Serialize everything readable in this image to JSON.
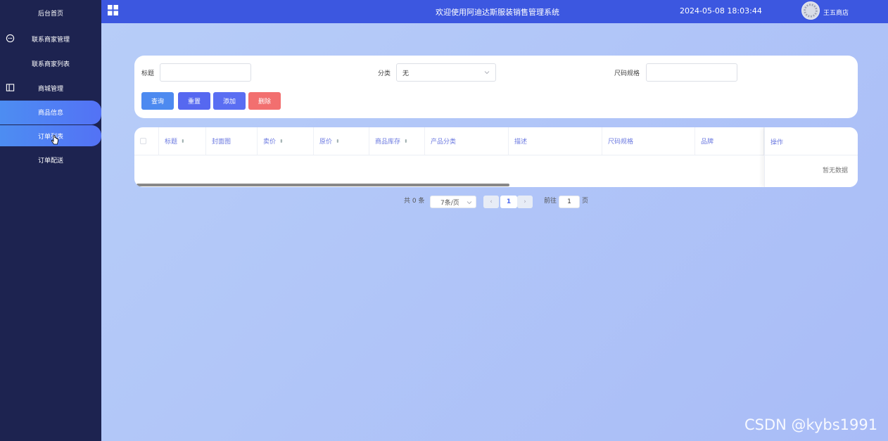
{
  "sidebar": {
    "items": [
      {
        "label": "后台首页"
      },
      {
        "label": "联系商家管理",
        "icon": "chat-icon"
      },
      {
        "label": "联系商家列表"
      },
      {
        "label": "商城管理",
        "icon": "columns-icon"
      },
      {
        "label": "商品信息"
      },
      {
        "label": "订单列表"
      },
      {
        "label": "订单配送"
      }
    ]
  },
  "header": {
    "title": "欢迎使用阿迪达斯服装销售管理系统",
    "datetime": "2024-05-08 18:03:44",
    "username": "王五商店"
  },
  "search": {
    "fields": [
      {
        "label": "标题",
        "value": ""
      },
      {
        "label": "分类",
        "value": "无"
      },
      {
        "label": "尺码规格",
        "value": ""
      }
    ],
    "buttons": [
      {
        "label": "查询",
        "color": "#4d8af0"
      },
      {
        "label": "重置",
        "color": "#5668f0"
      },
      {
        "label": "添加",
        "color": "#5a6ef2"
      },
      {
        "label": "删除",
        "color": "#f26f6f"
      }
    ]
  },
  "table": {
    "columns": [
      "标题",
      "封面图",
      "卖价",
      "原价",
      "商品库存",
      "产品分类",
      "描述",
      "尺码规格",
      "品牌",
      "操作"
    ],
    "empty_text": "暂无数据"
  },
  "pagination": {
    "total": "共 0 条",
    "page_size": "7条/页",
    "current_page": "1",
    "goto_label": "前往",
    "goto_value": "1",
    "page_suffix": "页"
  },
  "watermark": "CSDN @kybs1991",
  "colors": {
    "sidebar_bg": "#1d2350",
    "header_bg": "#3c57e0",
    "accent": "#4d8af0"
  }
}
